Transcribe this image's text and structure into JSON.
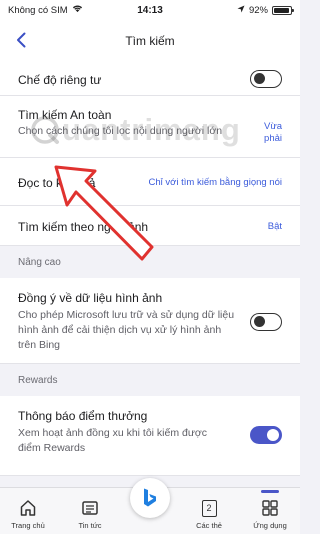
{
  "status_bar": {
    "carrier": "Không có SIM",
    "time": "14:13",
    "battery_percent": "92%",
    "battery_level": 0.92
  },
  "header": {
    "title": "Tìm kiếm",
    "back_icon": "chevron-left-icon"
  },
  "settings": {
    "private_mode": {
      "title": "Chế độ riêng tư",
      "enabled": false
    },
    "safe_search": {
      "title": "Tìm kiếm An toàn",
      "description": "Chọn cách chúng tôi lọc nội dung người lớn",
      "value": "Vừa phải"
    },
    "read_aloud": {
      "title": "Đọc to kết quả",
      "value": "Chỉ với tìm kiếm bằng giọng nói"
    },
    "context_search": {
      "title": "Tìm kiếm theo ngữ cảnh",
      "value": "Bật"
    }
  },
  "sections": {
    "advanced": "Nâng cao",
    "rewards": "Rewards"
  },
  "advanced": {
    "image_data": {
      "title": "Đồng ý về dữ liệu hình ảnh",
      "description": "Cho phép Microsoft lưu trữ và sử dụng dữ liệu hình ảnh để cải thiện dịch vụ xử lý hình ảnh trên Bing",
      "enabled": false
    }
  },
  "rewards": {
    "notifications": {
      "title": "Thông báo điểm thưởng",
      "description": "Xem hoạt ảnh đồng xu khi tôi kiếm được điểm Rewards",
      "enabled": true
    }
  },
  "watermark": "uantrimang",
  "tabs": [
    {
      "label": "Trang chủ",
      "icon": "home-icon"
    },
    {
      "label": "Tin tức",
      "icon": "news-icon"
    },
    {
      "label": "",
      "icon": "bing-logo-icon"
    },
    {
      "label": "Các thẻ",
      "icon": "tabs-icon",
      "count": "2"
    },
    {
      "label": "Ứng dụng",
      "icon": "apps-grid-icon",
      "active": true
    }
  ],
  "colors": {
    "accent": "#4a56c8",
    "link": "#3b5bdb",
    "annotation_arrow": "#e0322f"
  }
}
